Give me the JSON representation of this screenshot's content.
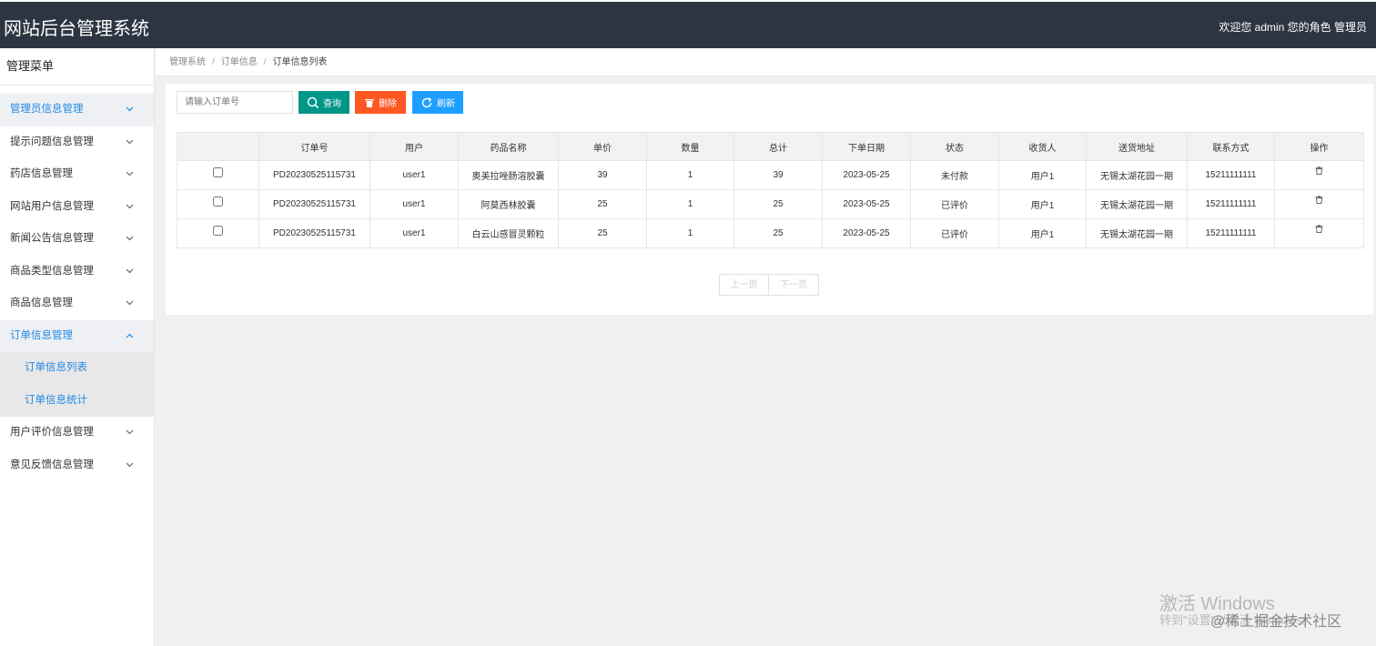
{
  "header": {
    "title": "网站后台管理系统",
    "welcome": "欢迎您 admin 您的角色 管理员"
  },
  "sidebar": {
    "title": "管理菜单",
    "items": [
      {
        "label": "管理员信息管理"
      },
      {
        "label": "提示问题信息管理"
      },
      {
        "label": "药店信息管理"
      },
      {
        "label": "网站用户信息管理"
      },
      {
        "label": "新闻公告信息管理"
      },
      {
        "label": "商品类型信息管理"
      },
      {
        "label": "商品信息管理"
      },
      {
        "label": "订单信息管理",
        "children": [
          {
            "label": "订单信息列表"
          },
          {
            "label": "订单信息统计"
          }
        ]
      },
      {
        "label": "用户评价信息管理"
      },
      {
        "label": "意见反馈信息管理"
      }
    ]
  },
  "breadcrumb": {
    "items": [
      "管理系统",
      "订单信息",
      "订单信息列表"
    ],
    "separator": "/"
  },
  "toolbar": {
    "search_placeholder": "请输入订单号",
    "query_label": "查询",
    "delete_label": "删除",
    "refresh_label": "刷新"
  },
  "table": {
    "headers": [
      "",
      "订单号",
      "用户",
      "药品名称",
      "单价",
      "数量",
      "总计",
      "下单日期",
      "状态",
      "收货人",
      "送货地址",
      "联系方式",
      "操作"
    ],
    "rows": [
      {
        "order_no": "PD20230525115731",
        "user": "user1",
        "drug": "奥美拉唑肠溶胶囊",
        "price": "39",
        "qty": "1",
        "total": "39",
        "date": "2023-05-25",
        "status": "未付款",
        "receiver": "用户1",
        "address": "无锡太湖花园一期",
        "phone": "15211111111"
      },
      {
        "order_no": "PD20230525115731",
        "user": "user1",
        "drug": "阿莫西林胶囊",
        "price": "25",
        "qty": "1",
        "total": "25",
        "date": "2023-05-25",
        "status": "已评价",
        "receiver": "用户1",
        "address": "无锡太湖花园一期",
        "phone": "15211111111"
      },
      {
        "order_no": "PD20230525115731",
        "user": "user1",
        "drug": "白云山感冒灵颗粒",
        "price": "25",
        "qty": "1",
        "total": "25",
        "date": "2023-05-25",
        "status": "已评价",
        "receiver": "用户1",
        "address": "无锡太湖花园一期",
        "phone": "15211111111"
      }
    ]
  },
  "pagination": {
    "prev_label": "上一页",
    "next_label": "下一页"
  },
  "watermark": {
    "activate": "激活 Windows",
    "activate_sub": "转到\"设置\"以激活 Windows。",
    "site": "@稀土掘金技术社区"
  },
  "colors": {
    "header_bg": "#2d3542",
    "accent": "#1e88e5",
    "query_btn": "#009688",
    "delete_btn": "#ff5722",
    "refresh_btn": "#1e9fff"
  },
  "icons": {
    "query": "search-icon",
    "delete": "trash-icon",
    "refresh": "refresh-icon",
    "row_action": "trash-icon",
    "menu_toggle": "chevron-icon"
  }
}
